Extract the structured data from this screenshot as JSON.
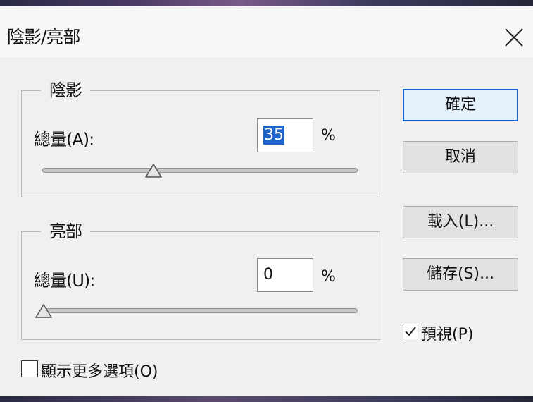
{
  "dialog": {
    "title": "陰影/亮部",
    "close_glyph": "X"
  },
  "shadows": {
    "legend": "陰影",
    "amount_label": "總量(A):",
    "amount_value": "35",
    "unit": "%",
    "slider_percent": 35
  },
  "highlights": {
    "legend": "亮部",
    "amount_label": "總量(U):",
    "amount_value": "0",
    "unit": "%",
    "slider_percent": 0
  },
  "buttons": {
    "ok": "確定",
    "cancel": "取消",
    "load": "載入(L)...",
    "save": "儲存(S)..."
  },
  "preview": {
    "label": "預視(P)",
    "checked": true
  },
  "more_options": {
    "label": "顯示更多選項(O)",
    "checked": false
  },
  "colors": {
    "accent": "#0a64d8",
    "selection": "#1f63c4",
    "background": "#f0f0f0"
  }
}
